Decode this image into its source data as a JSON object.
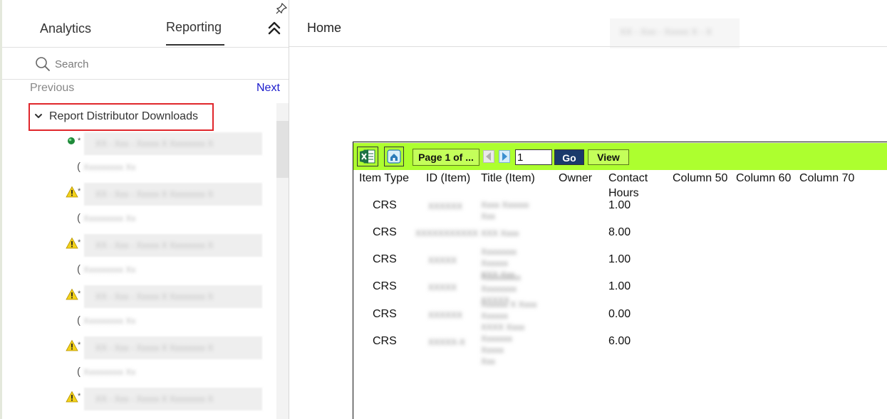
{
  "left_panel": {
    "tabs": [
      {
        "label": "Analytics"
      },
      {
        "label": "Reporting"
      }
    ],
    "search": {
      "placeholder": "Search"
    },
    "pagination": {
      "previous": "Previous",
      "next": "Next"
    },
    "tree": {
      "header": "Report Distributor Downloads",
      "items": [
        {
          "status_icon": "green-circle-icon",
          "marker": "*",
          "sub": "("
        },
        {
          "status_icon": "warning-icon",
          "marker": "*",
          "sub": "("
        },
        {
          "status_icon": "warning-icon",
          "marker": "*",
          "sub": "("
        },
        {
          "status_icon": "warning-icon",
          "marker": "*",
          "sub": "("
        },
        {
          "status_icon": "warning-icon",
          "marker": "*",
          "sub": "("
        },
        {
          "status_icon": "warning-icon",
          "marker": "*",
          "sub": ""
        }
      ]
    }
  },
  "main": {
    "breadcrumb": "Home"
  },
  "report": {
    "toolbar": {
      "excel_icon": "excel-export-icon",
      "home_icon": "home-icon",
      "page_indicator": "Page 1 of ...",
      "page_input_value": "1",
      "go_label": "Go",
      "view_label": "View",
      "accent_color": "#adff2f"
    },
    "columns": [
      "Item Type",
      "ID (Item)",
      "Title (Item)",
      "Owner",
      "Contact\nHours",
      "Column 50",
      "Column 60",
      "Column 70"
    ],
    "rows": [
      {
        "item_type": "CRS",
        "contact_hours": "1.00"
      },
      {
        "item_type": "CRS",
        "contact_hours": "8.00"
      },
      {
        "item_type": "CRS",
        "contact_hours": "1.00"
      },
      {
        "item_type": "CRS",
        "contact_hours": "1.00"
      },
      {
        "item_type": "CRS",
        "contact_hours": "0.00"
      },
      {
        "item_type": "CRS",
        "contact_hours": "6.00"
      }
    ]
  },
  "colors": {
    "highlight_box": "#e0262b",
    "next_link": "#1a1acc",
    "go_button": "#1a3a6b"
  }
}
